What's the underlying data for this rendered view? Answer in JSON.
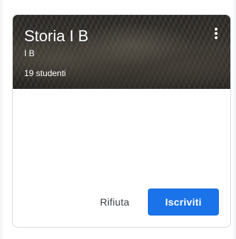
{
  "card": {
    "title": "Storia I B",
    "section": "I B",
    "students": "19 studenti",
    "menu_icon": "more-vert-icon"
  },
  "actions": {
    "decline_label": "Rifiuta",
    "join_label": "Iscriviti"
  },
  "colors": {
    "primary": "#1a73e8",
    "border": "#dadce0",
    "text": "#3c4043"
  }
}
